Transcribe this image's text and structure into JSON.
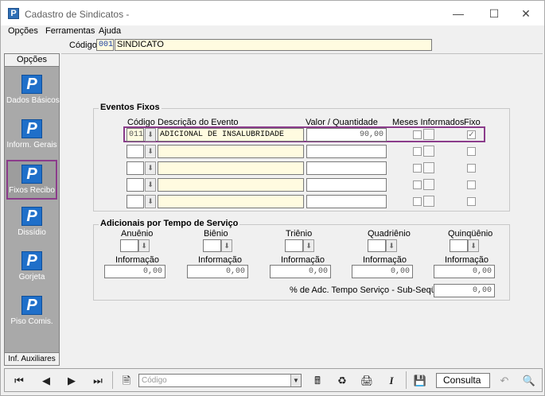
{
  "window": {
    "title": "Cadastro de Sindicatos -",
    "app_icon": "P"
  },
  "menu": [
    {
      "label": "Opções"
    },
    {
      "label": "Ferramentas"
    },
    {
      "label": "Ajuda"
    }
  ],
  "header": {
    "code_label": "Código:",
    "code_value": "001",
    "name_value": "SINDICATO"
  },
  "sidebar": {
    "title": "Opções",
    "footer": "Inf. Auxiliares",
    "items": [
      {
        "label": "Dados Básicos",
        "icon": "p-icon"
      },
      {
        "label": "Inform. Gerais",
        "icon": "p-icon"
      },
      {
        "label": "Fixos Recibo",
        "icon": "p-icon",
        "selected": true
      },
      {
        "label": "Dissídio",
        "icon": "p-icon"
      },
      {
        "label": "Gorjeta",
        "icon": "p-icon"
      },
      {
        "label": "Piso Comis.",
        "icon": "p-icon"
      }
    ]
  },
  "eventos_fixos": {
    "title": "Eventos Fixos",
    "headers": {
      "codigo": "Código",
      "descricao": "Descrição do Evento",
      "valor": "Valor / Quantidade",
      "meses": "Meses Informados",
      "fixo": "Fixo"
    },
    "rows": [
      {
        "codigo": "011",
        "descricao": "ADICIONAL DE INSALUBRIDADE",
        "valor": "90,00",
        "fixo_checked": true
      },
      {
        "codigo": "",
        "descricao": "",
        "valor": "",
        "fixo_checked": false
      },
      {
        "codigo": "",
        "descricao": "",
        "valor": "",
        "fixo_checked": false
      },
      {
        "codigo": "",
        "descricao": "",
        "valor": "",
        "fixo_checked": false
      },
      {
        "codigo": "",
        "descricao": "",
        "valor": "",
        "fixo_checked": false
      }
    ]
  },
  "adicionais": {
    "title": "Adicionais por Tempo de Serviço",
    "columns": [
      {
        "label": "Anuênio",
        "info_label": "Informação",
        "info_value": "0,00"
      },
      {
        "label": "Biênio",
        "info_label": "Informação",
        "info_value": "0,00"
      },
      {
        "label": "Triênio",
        "info_label": "Informação",
        "info_value": "0,00"
      },
      {
        "label": "Quadriênio",
        "info_label": "Informação",
        "info_value": "0,00"
      },
      {
        "label": "Quinqüênio",
        "info_label": "Informação",
        "info_value": "0,00"
      }
    ],
    "sub_sequente_label": "% de Adc. Tempo Serviço - Sub-Seqüente:",
    "sub_sequente_value": "0,00"
  },
  "toolbar": {
    "search_placeholder": "Código",
    "status": "Consulta"
  }
}
